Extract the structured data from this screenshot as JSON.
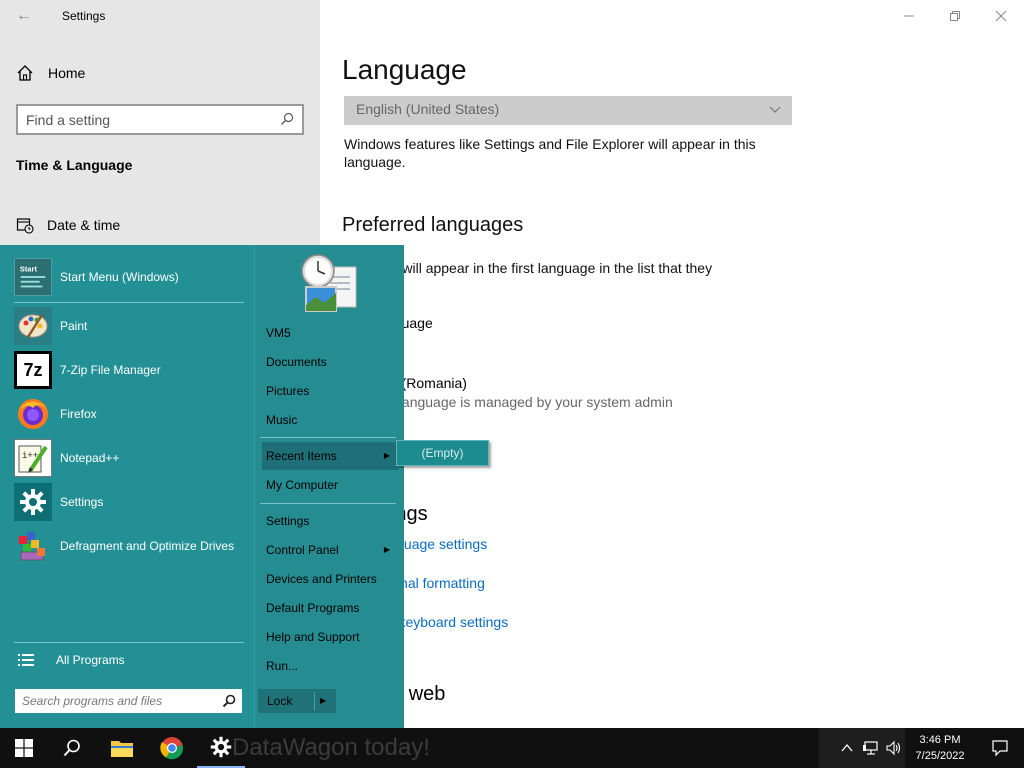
{
  "settings": {
    "app_title": "Settings",
    "home_label": "Home",
    "search_placeholder": "Find a setting",
    "section_title": "Time & Language",
    "nav_date_time": "Date & time"
  },
  "content": {
    "heading": "Language",
    "display_language_value": "English (United States)",
    "display_language_desc": "Windows features like Settings and File Explorer will appear in this language.",
    "preferred_heading": "Preferred languages",
    "preferred_desc": "websites will appear in the first language in the list that they",
    "add_language": "dd a language",
    "language_item": "omanian (Romania)",
    "language_item_note": "his PC's language is managed by your system admin",
    "related_heading": "d settings",
    "links": [
      "ative language settings",
      "e & regional formatting",
      "yping, & keyboard settings"
    ],
    "web_heading": "om the web"
  },
  "start_menu": {
    "programs": [
      {
        "label": "Start Menu (Windows)",
        "icon": "start-menu-icon"
      },
      {
        "label": "Paint",
        "icon": "paint-icon"
      },
      {
        "label": "7-Zip File Manager",
        "icon": "7zip-icon"
      },
      {
        "label": "Firefox",
        "icon": "firefox-icon"
      },
      {
        "label": "Notepad++",
        "icon": "notepadpp-icon"
      },
      {
        "label": "Settings",
        "icon": "gear-icon"
      },
      {
        "label": "Defragment and Optimize Drives",
        "icon": "defrag-icon"
      }
    ],
    "start_tile_text": "Start",
    "all_programs": "All Programs",
    "search_placeholder": "Search programs and files",
    "right_links": [
      "VM5",
      "Documents",
      "Pictures",
      "Music"
    ],
    "recent_items": "Recent Items",
    "recent_flyout": "(Empty)",
    "my_computer": "My Computer",
    "settings_links": [
      "Settings",
      "Control Panel",
      "Devices and Printers",
      "Default Programs",
      "Help and Support",
      "Run..."
    ],
    "lock": "Lock"
  },
  "taskbar": {
    "ghost_text": "DataWagon today!",
    "time": "3:46 PM",
    "date": "7/25/2022"
  },
  "colors": {
    "start_menu_bg": "#239095",
    "link": "#0a6cc4",
    "taskbar": "#101010"
  }
}
